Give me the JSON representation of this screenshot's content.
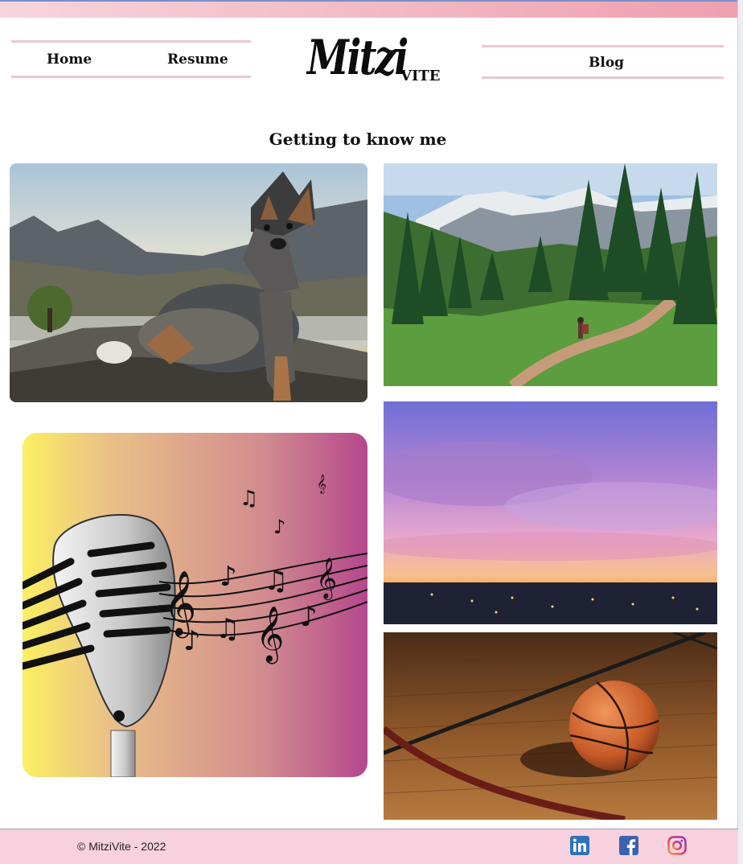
{
  "nav": {
    "home_label": "Home",
    "resume_label": "Resume",
    "blog_label": "Blog"
  },
  "logo": {
    "script_text": "Mitzi",
    "caps_text": "VITE"
  },
  "main": {
    "title": "Getting to know me"
  },
  "footer": {
    "copyright": "© MitziVite - 2022"
  },
  "images": [
    {
      "subject": "dog-on-rock-at-lake"
    },
    {
      "subject": "mountain-trail-hiker"
    },
    {
      "subject": "microphone-music-notes"
    },
    {
      "subject": "purple-sunset-over-city"
    },
    {
      "subject": "basketball-on-court"
    }
  ],
  "colors": {
    "accent_pink": "#ecc8cf",
    "footer_bg": "#f7d1dd",
    "linkedin": "#0a66c2",
    "facebook": "#1877f2",
    "instagram": "#c13584"
  },
  "icons": [
    "linkedin-icon",
    "facebook-icon",
    "instagram-icon"
  ]
}
